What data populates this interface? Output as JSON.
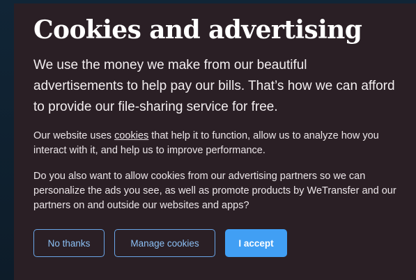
{
  "dialog": {
    "title": "Cookies and advertising",
    "lead": "We use the money we make from our beautiful advertisements to help pay our bills. That’s how we can afford to provide our file-sharing service for free.",
    "paragraph1_before": "Our website uses ",
    "paragraph1_link": "cookies",
    "paragraph1_after": " that help it to function, allow us to analyze how you interact with it, and help us to improve performance.",
    "paragraph2": "Do you also want to allow cookies from our advertising partners so we can personalize the ads you see, as well as promote products by WeTransfer and our partners on and outside our websites and apps?"
  },
  "actions": {
    "no_thanks": "No thanks",
    "manage_cookies": "Manage cookies",
    "accept": "I accept"
  },
  "colors": {
    "dialog_background": "#2a1f25",
    "accent": "#419ff4",
    "page_background": "#0f1f2c"
  }
}
